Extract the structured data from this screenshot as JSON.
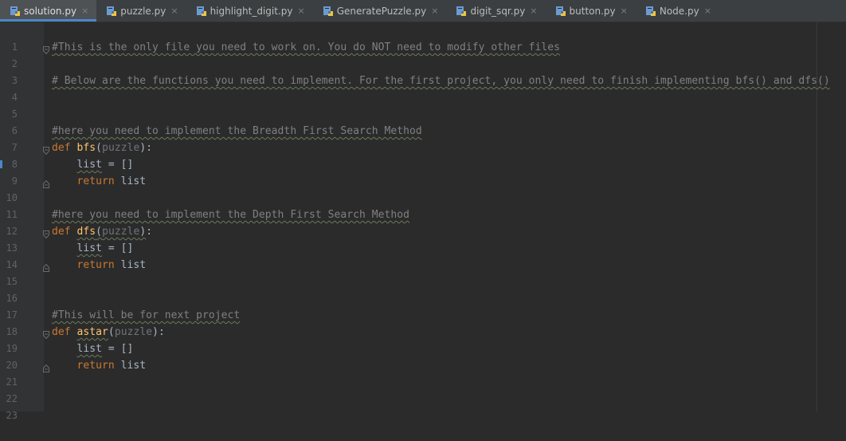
{
  "tabs": [
    {
      "label": "solution.py",
      "active": true
    },
    {
      "label": "puzzle.py",
      "active": false
    },
    {
      "label": "highlight_digit.py",
      "active": false
    },
    {
      "label": "GeneratePuzzle.py",
      "active": false
    },
    {
      "label": "digit_sqr.py",
      "active": false
    },
    {
      "label": "button.py",
      "active": false
    },
    {
      "label": "Node.py",
      "active": false
    }
  ],
  "close_glyph": "×",
  "line_numbers": [
    "1",
    "2",
    "3",
    "4",
    "5",
    "6",
    "7",
    "8",
    "9",
    "10",
    "11",
    "12",
    "13",
    "14",
    "15",
    "16",
    "17",
    "18",
    "19",
    "20",
    "21",
    "22",
    "23"
  ],
  "code": {
    "l2": "#This is the only file you need to work on. You do NOT need to modify other files",
    "l4": "# Below are the functions you need to implement. For the first project, you only need to finish implementing bfs() and dfs()",
    "l7": "#here you need to implement the Breadth First Search Method",
    "def": "def",
    "bfs": "bfs",
    "dfs": "dfs",
    "astar": "astar",
    "puzzle": "puzzle",
    "open_paren": "(",
    "close_paren_colon": "):",
    "close_paren": ")",
    "colon": ":",
    "indent": "    ",
    "list": "list",
    "assign_empty": " = []",
    "return": "return",
    "return_value": " list",
    "l12": "#here you need to implement the Depth First Search Method",
    "l18": "#This will be for next project"
  },
  "colors": {
    "background": "#2b2b2b",
    "gutter": "#313335",
    "tabbar": "#3c3f41",
    "active_tab_underline": "#4a88c7",
    "comment": "#808080",
    "keyword": "#cc7832",
    "function": "#ffc66d",
    "parameter": "#72737a"
  },
  "icons": {
    "tab_file": "python-file-icon",
    "fold": "fold-marker-icon"
  }
}
